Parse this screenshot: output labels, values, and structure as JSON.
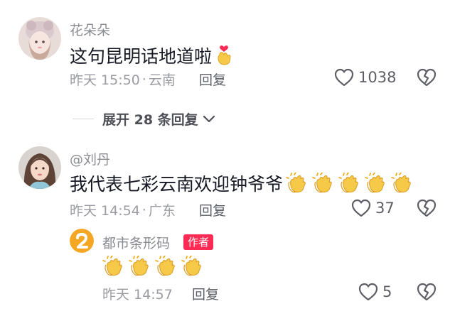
{
  "colors": {
    "accent": "#fe2c55",
    "meta": "#9b9ca1",
    "text": "#161823"
  },
  "comments": [
    {
      "username": "花朵朵",
      "text": "这句昆明话地道啦",
      "emoji": "heart-hand-emoji",
      "time": "昨天 15:50",
      "location": "云南",
      "reply_label": "回复",
      "likes": "1038",
      "expand_label": "展开 28 条回复"
    },
    {
      "username": "@刘丹",
      "text": "我代表七彩云南欢迎钟爷爷",
      "emoji": "clapping-hands-emoji",
      "time": "昨天 14:54",
      "location": "广东",
      "reply_label": "回复",
      "likes": "37"
    }
  ],
  "reply": {
    "username": "都市条形码",
    "tag": "作者",
    "emoji": "clapping-hands-emoji",
    "time": "昨天 14:57",
    "reply_label": "回复",
    "likes": "5"
  }
}
